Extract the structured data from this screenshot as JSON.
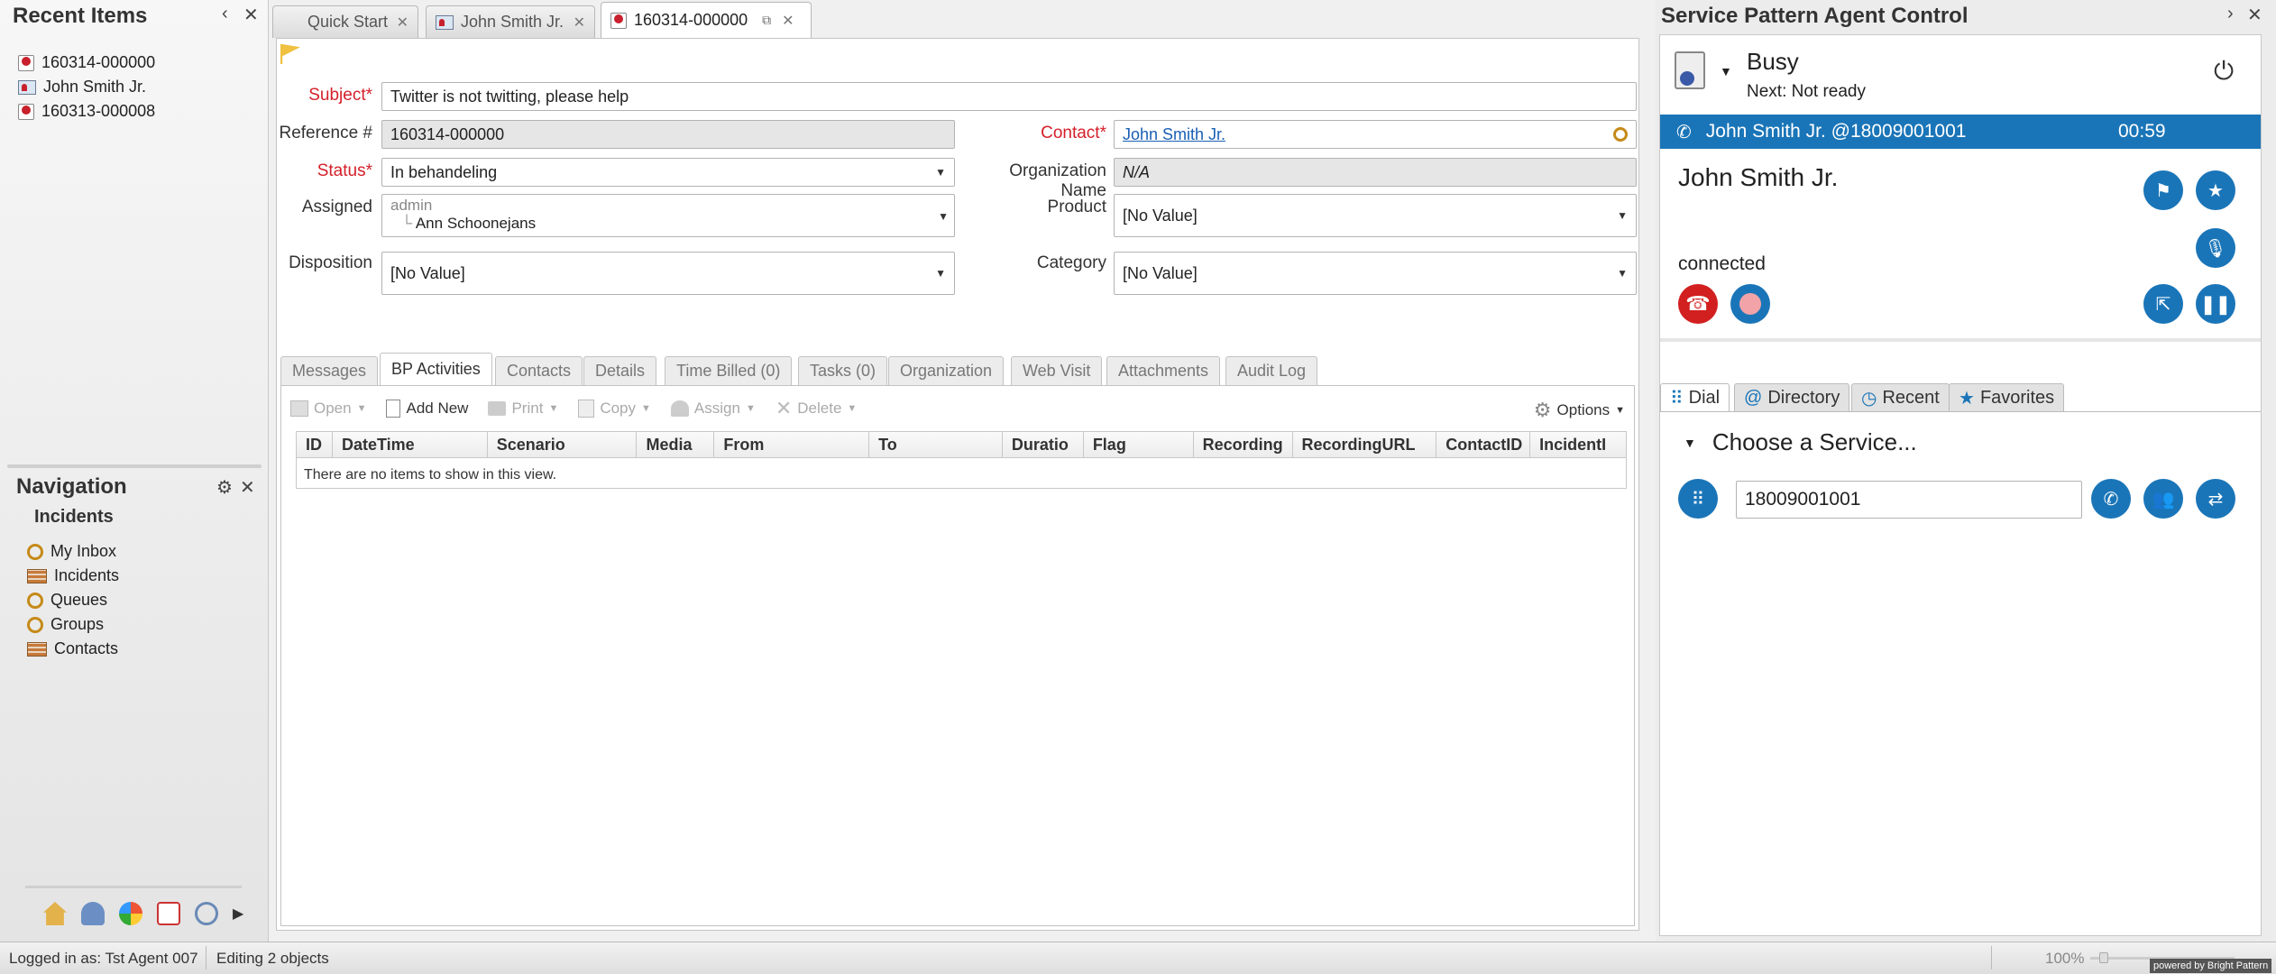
{
  "recent": {
    "title": "Recent Items",
    "items": [
      {
        "label": "160314-000000",
        "icon": "incident-icon"
      },
      {
        "label": "John Smith Jr.",
        "icon": "contact-icon"
      },
      {
        "label": "160313-000008",
        "icon": "incident-icon"
      }
    ]
  },
  "navigation": {
    "title": "Navigation",
    "section": "Incidents",
    "items": [
      {
        "label": "My Inbox",
        "icon": "report-search-icon"
      },
      {
        "label": "Incidents",
        "icon": "report-grid-icon"
      },
      {
        "label": "Queues",
        "icon": "report-search-icon"
      },
      {
        "label": "Groups",
        "icon": "report-search-icon"
      },
      {
        "label": "Contacts",
        "icon": "report-grid-icon"
      }
    ]
  },
  "tabs": [
    {
      "label": "Quick Start"
    },
    {
      "label": "John Smith Jr."
    },
    {
      "label": "160314-000000"
    }
  ],
  "form": {
    "subject_label": "Subject",
    "subject_value": "Twitter is not twitting, please help",
    "reference_label": "Reference #",
    "reference_value": "160314-000000",
    "contact_label": "Contact",
    "contact_value": "John Smith Jr.",
    "status_label": "Status",
    "status_value": "In behandeling",
    "org_label": "Organization Name",
    "org_value": "N/A",
    "assigned_label": "Assigned",
    "assigned_group": "admin",
    "assigned_user": "Ann Schoonejans",
    "product_label": "Product",
    "product_value": "[No Value]",
    "disposition_label": "Disposition",
    "disposition_value": "[No Value]",
    "category_label": "Category",
    "category_value": "[No Value]",
    "required_mark": "*"
  },
  "subtabs": [
    {
      "label": "Messages"
    },
    {
      "label": "BP Activities"
    },
    {
      "label": "Contacts"
    },
    {
      "label": "Details"
    },
    {
      "label": "Time Billed (0)"
    },
    {
      "label": "Tasks (0)"
    },
    {
      "label": "Organization"
    },
    {
      "label": "Web Visit"
    },
    {
      "label": "Attachments"
    },
    {
      "label": "Audit Log"
    }
  ],
  "grid_toolbar": {
    "open": "Open",
    "add_new": "Add New",
    "print": "Print",
    "copy": "Copy",
    "assign": "Assign",
    "delete": "Delete",
    "options": "Options"
  },
  "grid": {
    "columns": [
      "ID",
      "DateTime",
      "Scenario",
      "Media",
      "From",
      "To",
      "Duratio",
      "Flag",
      "Recording",
      "RecordingURL",
      "ContactID",
      "IncidentI"
    ],
    "empty_text": "There are no items to show in this view."
  },
  "agent": {
    "title": "Service Pattern Agent Control",
    "status": "Busy",
    "next_status": "Next: Not ready",
    "call_bar_label": "John Smith Jr. @18009001001",
    "call_timer": "00:59",
    "caller_name": "John Smith Jr.",
    "call_state": "connected",
    "tabs": [
      {
        "label": "Dial",
        "icon": "keypad-icon"
      },
      {
        "label": "Directory",
        "icon": "at-icon"
      },
      {
        "label": "Recent",
        "icon": "clock-icon"
      },
      {
        "label": "Favorites",
        "icon": "star-icon"
      }
    ],
    "choose_service": "Choose a Service...",
    "dial_number": "18009001001",
    "accent_color": "#1a75b8"
  },
  "statusbar": {
    "logged_in": "Logged in as: Tst Agent 007",
    "editing": "Editing 2 objects",
    "zoom": "100%",
    "powered_by": "powered by Bright Pattern"
  }
}
